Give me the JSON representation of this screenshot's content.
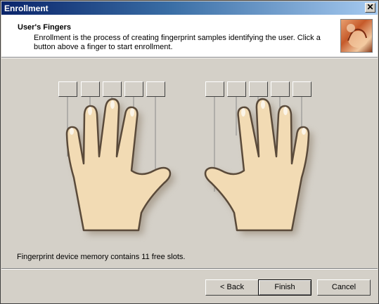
{
  "window": {
    "title": "Enrollment",
    "close_glyph": "✕"
  },
  "header": {
    "title": "User's Fingers",
    "description": "Enrollment is the process of creating fingerprint samples identifying the user. Click a button above a finger to start enrollment.",
    "image_icon": "fingerprint-hand-icon"
  },
  "status": {
    "text": "Fingerprint device memory contains 11 free slots."
  },
  "buttons": {
    "back_label": "< Back",
    "finish_label": "Finish",
    "cancel_label": "Cancel"
  },
  "colors": {
    "skin": "#f2dbb4",
    "outline": "#5a4a3a",
    "face": "#d4d0c8",
    "title_start": "#0a246a",
    "title_end": "#a6caf0"
  }
}
